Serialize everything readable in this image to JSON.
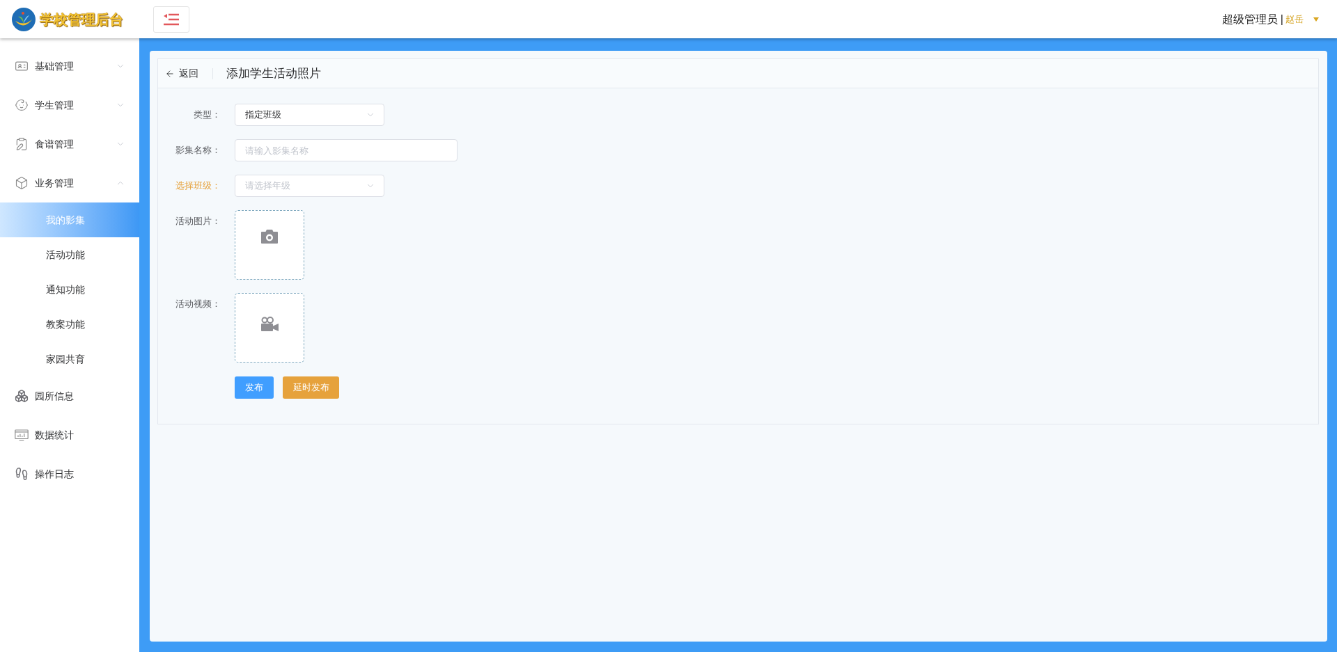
{
  "header": {
    "logo_text": "学校管理后台",
    "user_role": "超级管理员",
    "separator": "|",
    "user_name": "赵岳"
  },
  "sidebar": {
    "items": [
      {
        "kind": "group",
        "label": "基础管理",
        "expanded": false
      },
      {
        "kind": "group",
        "label": "学生管理",
        "expanded": false
      },
      {
        "kind": "group",
        "label": "食谱管理",
        "expanded": false
      },
      {
        "kind": "group",
        "label": "业务管理",
        "expanded": true,
        "children": [
          {
            "label": "我的影集",
            "selected": true
          },
          {
            "label": "活动功能",
            "selected": false
          },
          {
            "label": "通知功能",
            "selected": false
          },
          {
            "label": "教案功能",
            "selected": false
          },
          {
            "label": "家园共育",
            "selected": false
          }
        ]
      },
      {
        "kind": "link",
        "label": "园所信息"
      },
      {
        "kind": "link",
        "label": "数据统计"
      },
      {
        "kind": "link",
        "label": "操作日志"
      }
    ]
  },
  "page_header": {
    "back": "返回",
    "title": "添加学生活动照片"
  },
  "form": {
    "fields": [
      {
        "kind": "select",
        "label": "类型：",
        "value": "指定班级",
        "highlighted": false
      },
      {
        "kind": "text",
        "label": "影集名称：",
        "placeholder": "请输入影集名称",
        "highlighted": false
      },
      {
        "kind": "select",
        "label": "选择班级：",
        "placeholder": "请选择年级",
        "highlighted": true
      },
      {
        "kind": "photo_upload",
        "label": "活动图片：",
        "highlighted": false
      },
      {
        "kind": "video_upload",
        "label": "活动视频：",
        "highlighted": false
      }
    ],
    "buttons": [
      {
        "kind": "primary",
        "label": "发布"
      },
      {
        "kind": "warning",
        "label": "延时发布"
      }
    ]
  }
}
